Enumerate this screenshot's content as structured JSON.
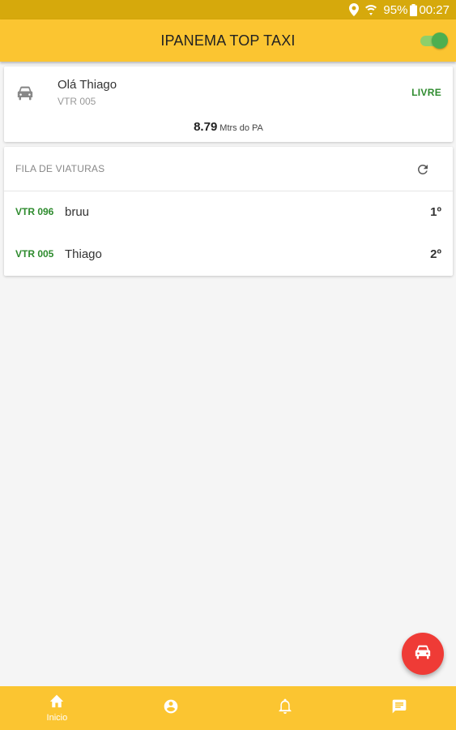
{
  "status_bar": {
    "battery": "95%",
    "time": "00:27"
  },
  "app_bar": {
    "title": "IPANEMA TOP TAXI",
    "toggle_on": true
  },
  "driver_card": {
    "greeting": "Olá Thiago",
    "vehicle_code": "VTR 005",
    "status": "LIVRE",
    "distance_value": "8.79",
    "distance_unit": "Mtrs do PA",
    "icon": "car-icon"
  },
  "queue": {
    "title": "FILA DE VIATURAS",
    "rows": [
      {
        "code": "VTR 096",
        "name": "bruu",
        "position": "1º"
      },
      {
        "code": "VTR 005",
        "name": "Thiago",
        "position": "2º"
      }
    ]
  },
  "bottom_nav": {
    "items": [
      {
        "label": "Inicio",
        "icon": "home-icon"
      },
      {
        "label": "",
        "icon": "account-icon"
      },
      {
        "label": "",
        "icon": "bell-icon"
      },
      {
        "label": "",
        "icon": "message-icon"
      }
    ]
  },
  "colors": {
    "primary": "#fbc531",
    "status_bar": "#d6a90c",
    "accent_green": "#2e8b2e",
    "fab": "#ef3b36"
  }
}
